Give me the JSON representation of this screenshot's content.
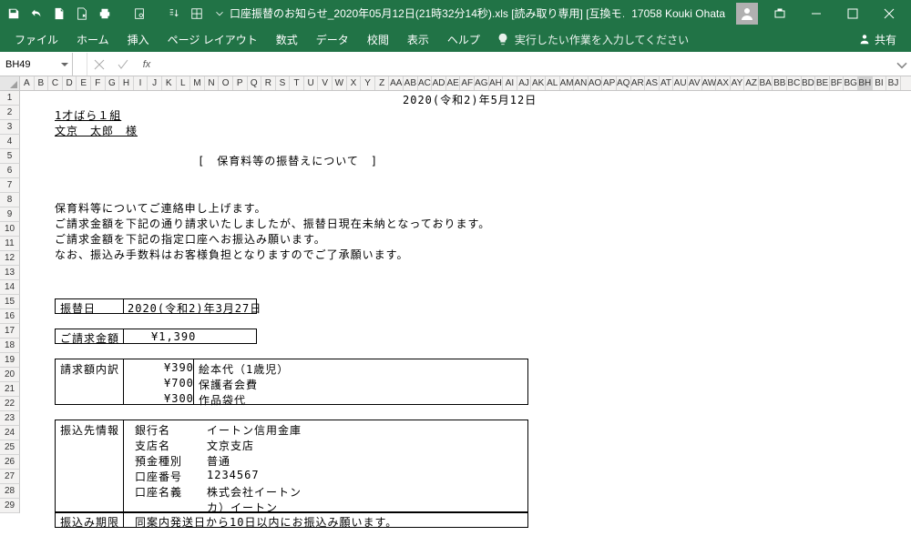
{
  "titlebar": {
    "filename": "口座振替のお知らせ_2020年05月12日(21時32分14秒).xls  [読み取り専用]  [互換モ…",
    "user": "17058 Kouki Ohata"
  },
  "ribbon": {
    "tabs": [
      "ファイル",
      "ホーム",
      "挿入",
      "ページ レイアウト",
      "数式",
      "データ",
      "校閲",
      "表示",
      "ヘルプ"
    ],
    "tellme": "実行したい作業を入力してください",
    "share": "共有"
  },
  "fx": {
    "name": "BH49",
    "formula": ""
  },
  "columns": [
    "A",
    "B",
    "C",
    "D",
    "E",
    "F",
    "G",
    "H",
    "I",
    "J",
    "K",
    "L",
    "M",
    "N",
    "O",
    "P",
    "Q",
    "R",
    "S",
    "T",
    "U",
    "V",
    "W",
    "X",
    "Y",
    "Z",
    "AA",
    "AB",
    "AC",
    "AD",
    "AE",
    "AF",
    "AG",
    "AH",
    "AI",
    "AJ",
    "AK",
    "AL",
    "AM",
    "AN",
    "AO",
    "AP",
    "AQ",
    "AR",
    "AS",
    "AT",
    "AU",
    "AV",
    "AW",
    "AX",
    "AY",
    "AZ",
    "BA",
    "BB",
    "BC",
    "BD",
    "BE",
    "BF",
    "BG",
    "BH",
    "BI",
    "BJ"
  ],
  "selectedCol": "BH",
  "rows": [
    "1",
    "2",
    "3",
    "4",
    "5",
    "6",
    "7",
    "8",
    "9",
    "10",
    "11",
    "12",
    "13",
    "14",
    "15",
    "16",
    "17",
    "18",
    "19",
    "20",
    "21",
    "22",
    "23",
    "24",
    "25",
    "26",
    "27",
    "28",
    "29"
  ],
  "doc": {
    "date": "2020(令和2)年5月12日",
    "class": "1才ばら１組",
    "name": "文京　太郎　様",
    "title": "[　保育料等の振替えについて　]",
    "p1": "保育料等についてご連絡申し上げます。",
    "p2": "ご請求金額を下記の通り請求いたしましたが、振替日現在未納となっております。",
    "p3": "ご請求金額を下記の指定口座へお振込み願います。",
    "p4": "なお、振込み手数料はお客様負担となりますのでご了承願います。",
    "transferDateLabel": "振替日",
    "transferDate": "2020(令和2)年3月27日",
    "amountLabel": "ご請求金額",
    "amount": "¥1,390",
    "breakdownLabel": "請求額内訳",
    "items": [
      {
        "amt": "¥390",
        "desc": "絵本代（1歳児）"
      },
      {
        "amt": "¥700",
        "desc": "保護者会費"
      },
      {
        "amt": "¥300",
        "desc": "作品袋代"
      }
    ],
    "bankLabel": "振込先情報",
    "bank": {
      "l1": "銀行名",
      "v1": "イートン信用金庫",
      "l2": "支店名",
      "v2": "文京支店",
      "l3": "預金種別",
      "v3": "普通",
      "l4": "口座番号",
      "v4": "1234567",
      "l5": "口座名義",
      "v5": "株式会社イートン",
      "v6": "カ）イートン"
    },
    "deadlineLabel": "振込み期限",
    "deadline": "同案内発送日から10日以内にお振込み願います。"
  }
}
